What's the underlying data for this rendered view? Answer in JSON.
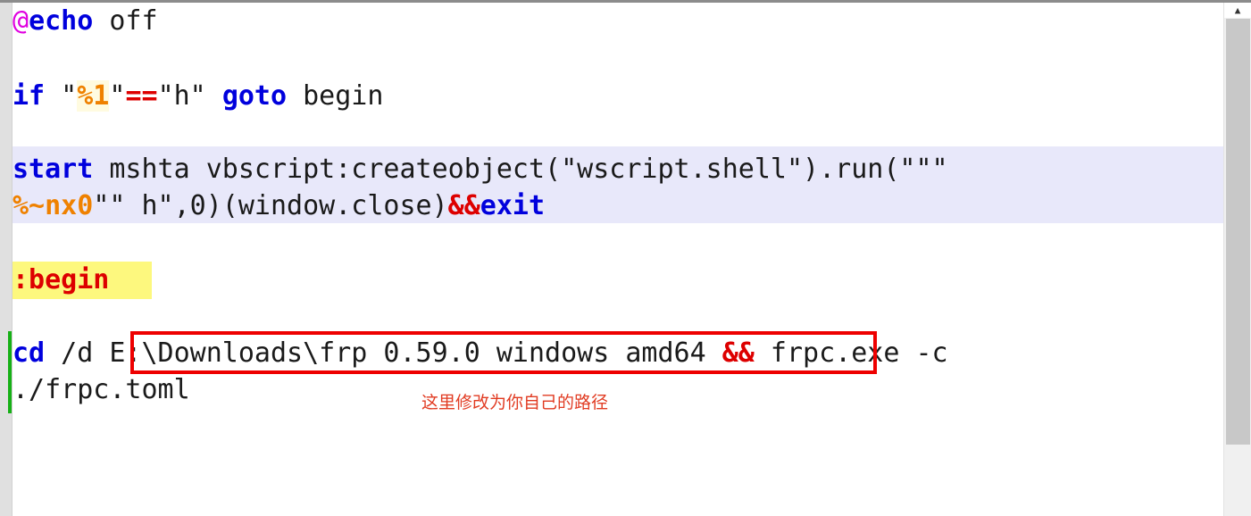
{
  "editor": {
    "language": "batch",
    "colors": {
      "keyword": "#0000dd",
      "variable": "#ef8100",
      "operator": "#dd0000",
      "label": "#dd0000",
      "at_symbol": "#e000e0",
      "plain": "#1a1a1a",
      "selection_highlight": "#e8e8fa",
      "search_highlight": "#fdf87e",
      "change_bar": "#16b016",
      "annotation": "#ee0000",
      "gutter": "#e0e0e0"
    },
    "lines": [
      {
        "id": "line-echo-off",
        "tokens": [
          {
            "text": "@",
            "kind": "at"
          },
          {
            "text": "echo",
            "kind": "kw"
          },
          {
            "text": " off",
            "kind": "plain"
          }
        ]
      },
      {
        "id": "line-if-goto",
        "tokens": [
          {
            "text": "if",
            "kind": "kw"
          },
          {
            "text": " \"",
            "kind": "plain"
          },
          {
            "text": "%1",
            "kind": "var-hl"
          },
          {
            "text": "\"",
            "kind": "plain"
          },
          {
            "text": "==",
            "kind": "op"
          },
          {
            "text": "\"h\" ",
            "kind": "plain"
          },
          {
            "text": "goto",
            "kind": "kw"
          },
          {
            "text": " begin",
            "kind": "plain"
          }
        ]
      },
      {
        "id": "line-start-mshta",
        "tokens": [
          {
            "text": "start",
            "kind": "kw"
          },
          {
            "text": " mshta vbscript:createobject(\"wscript.shell\").run(\"\"\"",
            "kind": "plain"
          }
        ]
      },
      {
        "id": "line-start-mshta-wrap",
        "tokens": [
          {
            "text": "%~nx0",
            "kind": "var"
          },
          {
            "text": "\"\" h\",0)(window.close)",
            "kind": "plain"
          },
          {
            "text": "&&",
            "kind": "op"
          },
          {
            "text": "exit",
            "kind": "kw"
          }
        ]
      },
      {
        "id": "line-begin-label",
        "tokens": [
          {
            "text": ":begin",
            "kind": "label"
          }
        ]
      },
      {
        "id": "line-cd-frpc",
        "tokens": [
          {
            "text": "cd",
            "kind": "kw"
          },
          {
            "text": " /d E:\\Downloads\\frp 0.59.0 windows amd64 ",
            "kind": "plain"
          },
          {
            "text": "&&",
            "kind": "op"
          },
          {
            "text": " frpc.exe -c",
            "kind": "plain"
          }
        ]
      },
      {
        "id": "line-cd-frpc-wrap",
        "tokens": [
          {
            "text": "./frpc.toml",
            "kind": "plain"
          }
        ]
      }
    ]
  },
  "annotations": {
    "path_box_label": "E:\\Downloads\\frp 0.59.0 windows amd64",
    "note_text": "这里修改为你自己的路径"
  },
  "scrollbar": {
    "up_arrow_glyph": "▲",
    "position_label": "top"
  }
}
